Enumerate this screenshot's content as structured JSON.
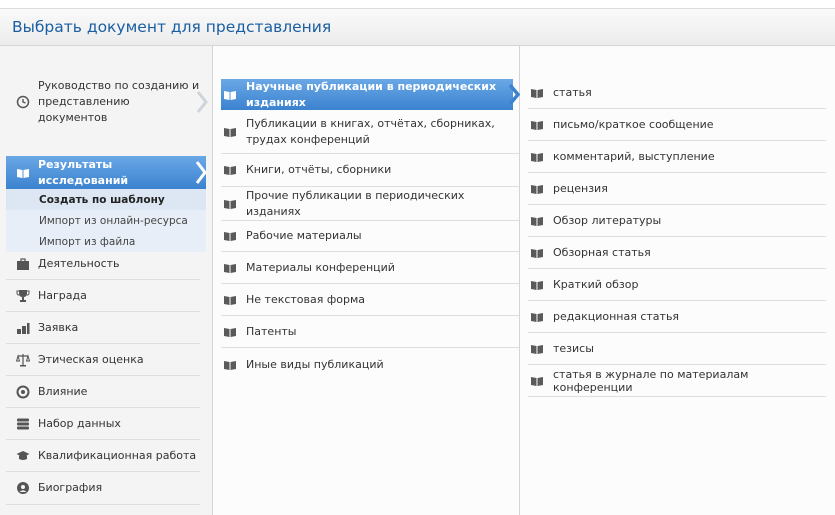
{
  "header": {
    "title": "Выбрать документ для представления"
  },
  "col1": {
    "guide": {
      "label": "Руководство по созданию и представлению документов",
      "icon": "clock-icon"
    },
    "active": {
      "label": "Результаты исследований",
      "icon": "book-icon"
    },
    "subitems": [
      {
        "label": "Создать по шаблону"
      },
      {
        "label": "Импорт из онлайн-ресурса"
      },
      {
        "label": "Импорт из файла"
      }
    ],
    "items": [
      {
        "label": "Деятельность",
        "icon": "briefcase-icon"
      },
      {
        "label": "Награда",
        "icon": "trophy-icon"
      },
      {
        "label": "Заявка",
        "icon": "coins-icon"
      },
      {
        "label": "Этическая оценка",
        "icon": "scales-icon"
      },
      {
        "label": "Влияние",
        "icon": "target-icon"
      },
      {
        "label": "Набор данных",
        "icon": "database-icon"
      },
      {
        "label": "Квалификационная работа",
        "icon": "graduation-cap-icon"
      },
      {
        "label": "Биография",
        "icon": "biography-icon"
      }
    ]
  },
  "col2": {
    "items": [
      {
        "label": "Научные публикации в периодических изданиях"
      },
      {
        "label": "Публикации в книгах, отчётах, сборниках, трудах конференций"
      },
      {
        "label": "Книги, отчёты, сборники"
      },
      {
        "label": "Прочие публикации в периодических изданиях"
      },
      {
        "label": "Рабочие материалы"
      },
      {
        "label": "Материалы конференций"
      },
      {
        "label": "Не текстовая форма"
      },
      {
        "label": "Патенты"
      },
      {
        "label": "Иные виды публикаций"
      }
    ]
  },
  "col3": {
    "items": [
      {
        "label": "статья"
      },
      {
        "label": "письмо/краткое сообщение"
      },
      {
        "label": "комментарий, выступление"
      },
      {
        "label": "рецензия"
      },
      {
        "label": "Обзор литературы"
      },
      {
        "label": "Обзорная статья"
      },
      {
        "label": "Краткий обзор"
      },
      {
        "label": "редакционная статья"
      },
      {
        "label": "тезисы"
      },
      {
        "label": "статья в журнале по материалам конференции"
      }
    ]
  },
  "colors": {
    "accent": "#3b82cf",
    "title": "#1a5ea3",
    "icon": "#5a5a5a"
  }
}
